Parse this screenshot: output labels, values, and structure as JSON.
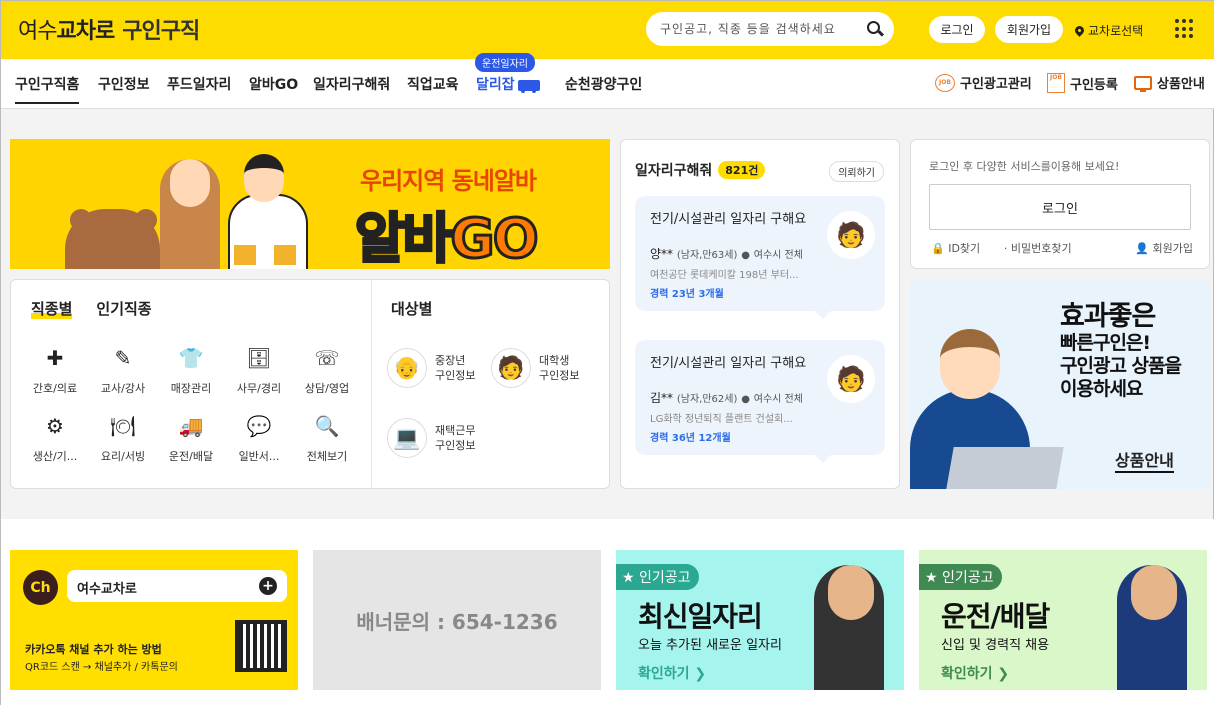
{
  "header": {
    "logo_part1": "여수",
    "logo_part2": "교차로",
    "logo_part3": "구인구직",
    "search_placeholder": "구인공고, 직종 등을 검색하세요",
    "login_label": "로그인",
    "signup_label": "회원가입",
    "location_label": "교차로선택"
  },
  "nav": {
    "items": [
      "구인구직홈",
      "구인정보",
      "푸드일자리",
      "알바GO",
      "일자리구해줘",
      "직업교육",
      "달리잡",
      "순천광양구인"
    ],
    "tag_bubble": "운전일자리",
    "right_items": [
      "구인광고관리",
      "구인등록",
      "상품안내"
    ],
    "job_icon_text": "JOB"
  },
  "banner_main": {
    "top_text": "우리지역 동네알바",
    "main_text_a": "알바",
    "main_text_b": "GO"
  },
  "categories": {
    "tabs": [
      "직종별",
      "인기직종"
    ],
    "target_title": "대상별",
    "items": [
      {
        "icon": "medical-kit-icon",
        "glyph": "✚",
        "label": "간호/의료"
      },
      {
        "icon": "teacher-icon",
        "glyph": "✎",
        "label": "교사/강사"
      },
      {
        "icon": "shirt-icon",
        "glyph": "👕",
        "label": "매장관리"
      },
      {
        "icon": "office-icon",
        "glyph": "🗄",
        "label": "사무/경리"
      },
      {
        "icon": "phone-icon",
        "glyph": "☏",
        "label": "상담/영업"
      },
      {
        "icon": "gear-icon",
        "glyph": "⚙",
        "label": "생산/기..."
      },
      {
        "icon": "dish-icon",
        "glyph": "🍽",
        "label": "요리/서빙"
      },
      {
        "icon": "truck-icon",
        "glyph": "🚚",
        "label": "운전/배달"
      },
      {
        "icon": "chat-icon",
        "glyph": "💬",
        "label": "일반서..."
      },
      {
        "icon": "search-icon",
        "glyph": "🔍",
        "label": "전체보기"
      }
    ],
    "targets": [
      {
        "icon": "elder-icon",
        "line1": "중장년",
        "line2": "구인정보"
      },
      {
        "icon": "student-icon",
        "line1": "대학생",
        "line2": "구인정보"
      },
      {
        "icon": "remote-work-icon",
        "line1": "재택근무",
        "line2": "구인정보"
      }
    ]
  },
  "seeker": {
    "title": "일자리구해줘",
    "count": "821건",
    "request_label": "의뢰하기",
    "cards": [
      {
        "title": "전기/시설관리 일자리 구해요",
        "name": "양**",
        "info": "(남자,만63세)",
        "region": "여수시 전체",
        "desc": "여천공단 롯데케미칼 198년 부터...",
        "career": "경력 23년 3개월"
      },
      {
        "title": "전기/시설관리 일자리 구해요",
        "name": "김**",
        "info": "(남자,만62세)",
        "region": "여수시 전체",
        "desc": "LG화학 정년퇴직 플랜트 건설회...",
        "career": "경력 36년 12개월"
      }
    ]
  },
  "login_box": {
    "message": "로그인 후 다양한 서비스를이용해 보세요!",
    "button": "로그인",
    "find_id": "ID찾기",
    "find_pw": "비밀번호찾기",
    "signup": "회원가입"
  },
  "ad_banner": {
    "line1": "효과좋은",
    "line2": "빠른구인은!",
    "line3": "구인광고 상품을",
    "line4": "이용하세요",
    "link": "상품안내"
  },
  "bottom_banners": {
    "kakao": {
      "ch": "Ch",
      "name": "여수교차로",
      "line1": "카카오톡 채널 추가 하는 방법",
      "line2": "QR코드 스캔 → 채널추가 / 카톡문의"
    },
    "inquiry": "배너문의 : 654-1236",
    "pop1": {
      "tag": "★ 인기공고",
      "title": "최신일자리",
      "sub": "오늘 추가된 새로운 일자리",
      "go": "확인하기 ❯",
      "bg": "#a6f4ee"
    },
    "pop2": {
      "tag": "★ 인기공고",
      "title": "운전/배달",
      "sub": "신입 및 경력직 채용",
      "go": "확인하기 ❯",
      "bg": "#d9f7c9"
    }
  }
}
